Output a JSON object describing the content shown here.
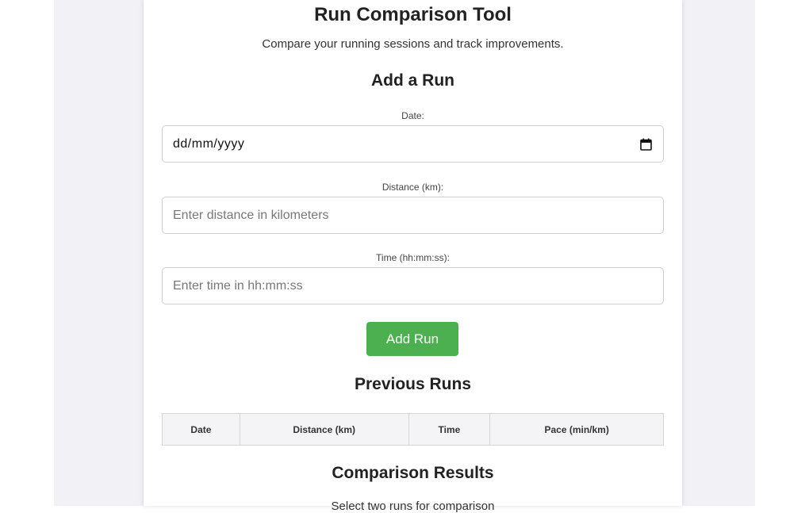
{
  "header": {
    "title": "Run Comparison Tool",
    "subtitle": "Compare your running sessions and track improvements."
  },
  "add_run": {
    "heading": "Add a Run",
    "date": {
      "label": "Date:",
      "value": "dd/mm/yyyy"
    },
    "distance": {
      "label": "Distance (km):",
      "placeholder": "Enter distance in kilometers"
    },
    "time": {
      "label": "Time (hh:mm:ss):",
      "placeholder": "Enter time in hh:mm:ss"
    },
    "button_label": "Add Run",
    "button_color": "#4caf50"
  },
  "previous_runs": {
    "heading": "Previous Runs",
    "columns": [
      "Date",
      "Distance (km)",
      "Time",
      "Pace (min/km)"
    ]
  },
  "comparison": {
    "heading": "Comparison Results",
    "note": "Select two runs for comparison"
  },
  "icons": {
    "date_picker": "calendar-icon"
  }
}
